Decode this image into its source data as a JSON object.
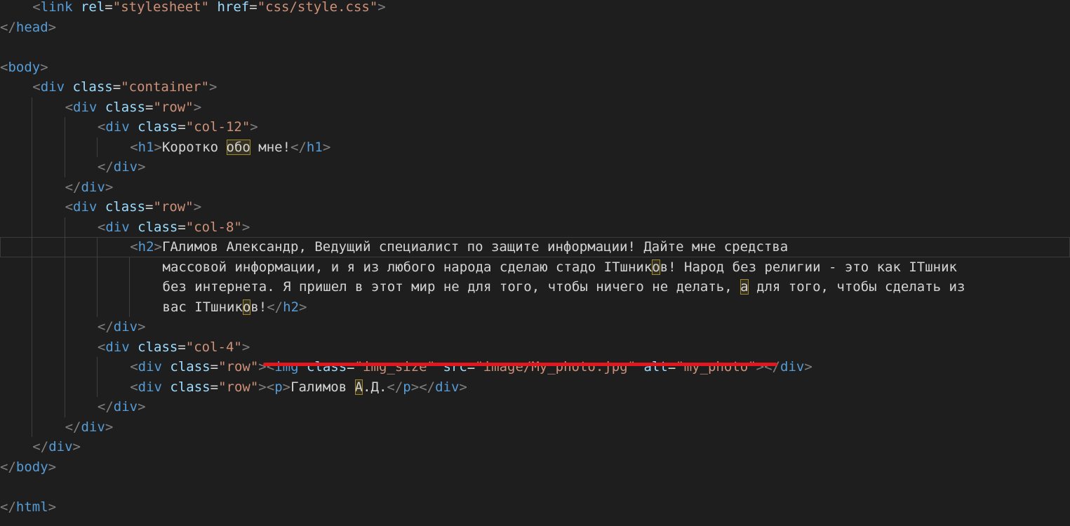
{
  "editor": {
    "theme": "dark",
    "colors": {
      "background": "#1e1e1e",
      "tag": "#569cd6",
      "attribute": "#9cdcfe",
      "string": "#ce9178",
      "bracket": "#808080",
      "text": "#d4d4d4",
      "annotation": "#e0171f"
    },
    "annotation": "red-underline",
    "lines": [
      {
        "indent": 1,
        "segments": [
          {
            "t": "bracket",
            "v": "<"
          },
          {
            "t": "tag",
            "v": "link"
          },
          {
            "t": "text",
            "v": " "
          },
          {
            "t": "attr",
            "v": "rel"
          },
          {
            "t": "eq",
            "v": "="
          },
          {
            "t": "str",
            "v": "\"stylesheet\""
          },
          {
            "t": "text",
            "v": " "
          },
          {
            "t": "attr",
            "v": "href"
          },
          {
            "t": "eq",
            "v": "="
          },
          {
            "t": "str",
            "v": "\"css/style.css\""
          },
          {
            "t": "bracket",
            "v": ">"
          }
        ]
      },
      {
        "indent": 0,
        "segments": [
          {
            "t": "bracket",
            "v": "</"
          },
          {
            "t": "tag",
            "v": "head"
          },
          {
            "t": "bracket",
            "v": ">"
          }
        ]
      },
      {
        "indent": 0,
        "segments": []
      },
      {
        "indent": 0,
        "segments": [
          {
            "t": "bracket",
            "v": "<"
          },
          {
            "t": "tag",
            "v": "body"
          },
          {
            "t": "bracket",
            "v": ">"
          }
        ]
      },
      {
        "indent": 1,
        "segments": [
          {
            "t": "bracket",
            "v": "<"
          },
          {
            "t": "tag",
            "v": "div"
          },
          {
            "t": "text",
            "v": " "
          },
          {
            "t": "attr",
            "v": "class"
          },
          {
            "t": "eq",
            "v": "="
          },
          {
            "t": "str",
            "v": "\"container\""
          },
          {
            "t": "bracket",
            "v": ">"
          }
        ]
      },
      {
        "indent": 2,
        "segments": [
          {
            "t": "bracket",
            "v": "<"
          },
          {
            "t": "tag",
            "v": "div"
          },
          {
            "t": "text",
            "v": " "
          },
          {
            "t": "attr",
            "v": "class"
          },
          {
            "t": "eq",
            "v": "="
          },
          {
            "t": "str",
            "v": "\"row\""
          },
          {
            "t": "bracket",
            "v": ">"
          }
        ]
      },
      {
        "indent": 3,
        "segments": [
          {
            "t": "bracket",
            "v": "<"
          },
          {
            "t": "tag",
            "v": "div"
          },
          {
            "t": "text",
            "v": " "
          },
          {
            "t": "attr",
            "v": "class"
          },
          {
            "t": "eq",
            "v": "="
          },
          {
            "t": "str",
            "v": "\"col-12\""
          },
          {
            "t": "bracket",
            "v": ">"
          }
        ]
      },
      {
        "indent": 4,
        "segments": [
          {
            "t": "bracket",
            "v": "<"
          },
          {
            "t": "tag",
            "v": "h1"
          },
          {
            "t": "bracket",
            "v": ">"
          },
          {
            "t": "text",
            "v": "Коротко "
          },
          {
            "t": "hl",
            "v": "обо"
          },
          {
            "t": "text",
            "v": " мне!"
          },
          {
            "t": "bracket",
            "v": "</"
          },
          {
            "t": "tag",
            "v": "h1"
          },
          {
            "t": "bracket",
            "v": ">"
          }
        ]
      },
      {
        "indent": 3,
        "segments": [
          {
            "t": "bracket",
            "v": "</"
          },
          {
            "t": "tag",
            "v": "div"
          },
          {
            "t": "bracket",
            "v": ">"
          }
        ]
      },
      {
        "indent": 2,
        "segments": [
          {
            "t": "bracket",
            "v": "</"
          },
          {
            "t": "tag",
            "v": "div"
          },
          {
            "t": "bracket",
            "v": ">"
          }
        ]
      },
      {
        "indent": 2,
        "segments": [
          {
            "t": "bracket",
            "v": "<"
          },
          {
            "t": "tag",
            "v": "div"
          },
          {
            "t": "text",
            "v": " "
          },
          {
            "t": "attr",
            "v": "class"
          },
          {
            "t": "eq",
            "v": "="
          },
          {
            "t": "str",
            "v": "\"row\""
          },
          {
            "t": "bracket",
            "v": ">"
          }
        ]
      },
      {
        "indent": 3,
        "segments": [
          {
            "t": "bracket",
            "v": "<"
          },
          {
            "t": "tag",
            "v": "div"
          },
          {
            "t": "text",
            "v": " "
          },
          {
            "t": "attr",
            "v": "class"
          },
          {
            "t": "eq",
            "v": "="
          },
          {
            "t": "str",
            "v": "\"col-8\""
          },
          {
            "t": "bracket",
            "v": ">"
          }
        ]
      },
      {
        "indent": 4,
        "current": true,
        "segments": [
          {
            "t": "bracket",
            "v": "<"
          },
          {
            "t": "tag",
            "v": "h2"
          },
          {
            "t": "bracket",
            "v": ">"
          },
          {
            "t": "text",
            "v": "ГАлимов Александр, Ведущий специалист по защите информации! Дайте мне средства"
          }
        ]
      },
      {
        "indent": 5,
        "segments": [
          {
            "t": "text",
            "v": "массовой информации, и я из любого народа сделаю стадо ITшник"
          },
          {
            "t": "hl",
            "v": "о"
          },
          {
            "t": "text",
            "v": "в! Народ без религии - это как ITшник"
          }
        ]
      },
      {
        "indent": 5,
        "segments": [
          {
            "t": "text",
            "v": "без интернета. Я пришел в этот мир не для того, чтобы ничего не делать, "
          },
          {
            "t": "hl",
            "v": "а"
          },
          {
            "t": "text",
            "v": " для того, чтобы сделать из"
          }
        ]
      },
      {
        "indent": 5,
        "segments": [
          {
            "t": "text",
            "v": "вас ITшник"
          },
          {
            "t": "hl",
            "v": "о"
          },
          {
            "t": "text",
            "v": "в!"
          },
          {
            "t": "bracket",
            "v": "</"
          },
          {
            "t": "tag",
            "v": "h2"
          },
          {
            "t": "bracket",
            "v": ">"
          }
        ]
      },
      {
        "indent": 3,
        "segments": [
          {
            "t": "bracket",
            "v": "</"
          },
          {
            "t": "tag",
            "v": "div"
          },
          {
            "t": "bracket",
            "v": ">"
          }
        ]
      },
      {
        "indent": 3,
        "segments": [
          {
            "t": "bracket",
            "v": "<"
          },
          {
            "t": "tag",
            "v": "div"
          },
          {
            "t": "text",
            "v": " "
          },
          {
            "t": "attr",
            "v": "class"
          },
          {
            "t": "eq",
            "v": "="
          },
          {
            "t": "str",
            "v": "\"col-4\""
          },
          {
            "t": "bracket",
            "v": ">"
          }
        ]
      },
      {
        "indent": 4,
        "segments": [
          {
            "t": "bracket",
            "v": "<"
          },
          {
            "t": "tag",
            "v": "div"
          },
          {
            "t": "text",
            "v": " "
          },
          {
            "t": "attr",
            "v": "class"
          },
          {
            "t": "eq",
            "v": "="
          },
          {
            "t": "str",
            "v": "\"row\""
          },
          {
            "t": "bracket",
            "v": ">"
          },
          {
            "t": "bracket",
            "v": "<"
          },
          {
            "t": "tag",
            "v": "img"
          },
          {
            "t": "text",
            "v": " "
          },
          {
            "t": "attr",
            "v": "class"
          },
          {
            "t": "eq",
            "v": "="
          },
          {
            "t": "str",
            "v": "\"img_size\""
          },
          {
            "t": "text",
            "v": " "
          },
          {
            "t": "attr",
            "v": "src"
          },
          {
            "t": "eq",
            "v": "="
          },
          {
            "t": "str",
            "v": "\"image/My_photo.jpg\""
          },
          {
            "t": "text",
            "v": " "
          },
          {
            "t": "attr",
            "v": "alt"
          },
          {
            "t": "eq",
            "v": "="
          },
          {
            "t": "str",
            "v": "\"my_photo\""
          },
          {
            "t": "bracket",
            "v": ">"
          },
          {
            "t": "bracket",
            "v": "</"
          },
          {
            "t": "tag",
            "v": "div"
          },
          {
            "t": "bracket",
            "v": ">"
          }
        ]
      },
      {
        "indent": 4,
        "segments": [
          {
            "t": "bracket",
            "v": "<"
          },
          {
            "t": "tag",
            "v": "div"
          },
          {
            "t": "text",
            "v": " "
          },
          {
            "t": "attr",
            "v": "class"
          },
          {
            "t": "eq",
            "v": "="
          },
          {
            "t": "str",
            "v": "\"row\""
          },
          {
            "t": "bracket",
            "v": ">"
          },
          {
            "t": "bracket",
            "v": "<"
          },
          {
            "t": "tag",
            "v": "p"
          },
          {
            "t": "bracket",
            "v": ">"
          },
          {
            "t": "text",
            "v": "Галимов "
          },
          {
            "t": "hl",
            "v": "А"
          },
          {
            "t": "text",
            "v": ".Д."
          },
          {
            "t": "bracket",
            "v": "</"
          },
          {
            "t": "tag",
            "v": "p"
          },
          {
            "t": "bracket",
            "v": ">"
          },
          {
            "t": "bracket",
            "v": "</"
          },
          {
            "t": "tag",
            "v": "div"
          },
          {
            "t": "bracket",
            "v": ">"
          }
        ]
      },
      {
        "indent": 3,
        "segments": [
          {
            "t": "bracket",
            "v": "</"
          },
          {
            "t": "tag",
            "v": "div"
          },
          {
            "t": "bracket",
            "v": ">"
          }
        ]
      },
      {
        "indent": 2,
        "segments": [
          {
            "t": "bracket",
            "v": "</"
          },
          {
            "t": "tag",
            "v": "div"
          },
          {
            "t": "bracket",
            "v": ">"
          }
        ]
      },
      {
        "indent": 1,
        "segments": [
          {
            "t": "bracket",
            "v": "</"
          },
          {
            "t": "tag",
            "v": "div"
          },
          {
            "t": "bracket",
            "v": ">"
          }
        ]
      },
      {
        "indent": 0,
        "segments": [
          {
            "t": "bracket",
            "v": "</"
          },
          {
            "t": "tag",
            "v": "body"
          },
          {
            "t": "bracket",
            "v": ">"
          }
        ]
      },
      {
        "indent": 0,
        "segments": []
      },
      {
        "indent": 0,
        "segments": [
          {
            "t": "bracket",
            "v": "</"
          },
          {
            "t": "tag",
            "v": "html"
          },
          {
            "t": "bracket",
            "v": ">"
          }
        ]
      }
    ]
  }
}
